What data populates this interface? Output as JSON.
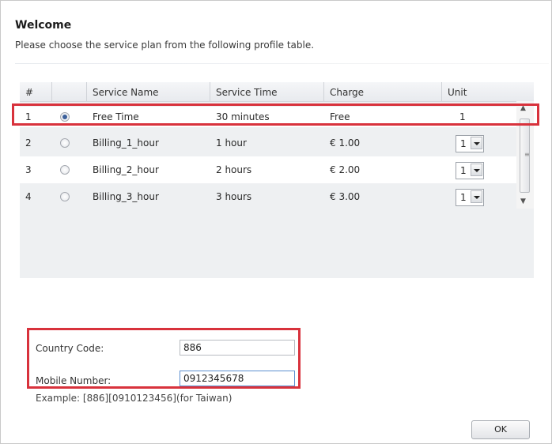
{
  "header": {
    "title": "Welcome",
    "subtitle": "Please choose the service plan from the following profile table."
  },
  "table": {
    "columns": [
      "#",
      "",
      "Service Name",
      "Service Time",
      "Charge",
      "Unit"
    ],
    "rows": [
      {
        "num": "1",
        "selected": true,
        "name": "Free Time",
        "time": "30 minutes",
        "charge": "Free",
        "unit": "1",
        "unit_dropdown": false
      },
      {
        "num": "2",
        "selected": false,
        "name": "Billing_1_hour",
        "time": "1 hour",
        "charge": "€ 1.00",
        "unit": "1",
        "unit_dropdown": true
      },
      {
        "num": "3",
        "selected": false,
        "name": "Billing_2_hour",
        "time": "2 hours",
        "charge": "€ 2.00",
        "unit": "1",
        "unit_dropdown": true
      },
      {
        "num": "4",
        "selected": false,
        "name": "Billing_3_hour",
        "time": "3 hours",
        "charge": "€ 3.00",
        "unit": "1",
        "unit_dropdown": true
      }
    ]
  },
  "form": {
    "country_code_label": "Country Code:",
    "country_code_value": "886",
    "mobile_number_label": "Mobile Number:",
    "mobile_number_value": "0912345678",
    "example": "Example: [886][0910123456](for Taiwan)"
  },
  "buttons": {
    "ok": "OK"
  },
  "icons": {
    "scroll_up": "▲",
    "scroll_down": "▼",
    "scroll_grip": "≡"
  },
  "colors": {
    "highlight": "#d8323c",
    "radio_selected": "#3b5f9a"
  }
}
